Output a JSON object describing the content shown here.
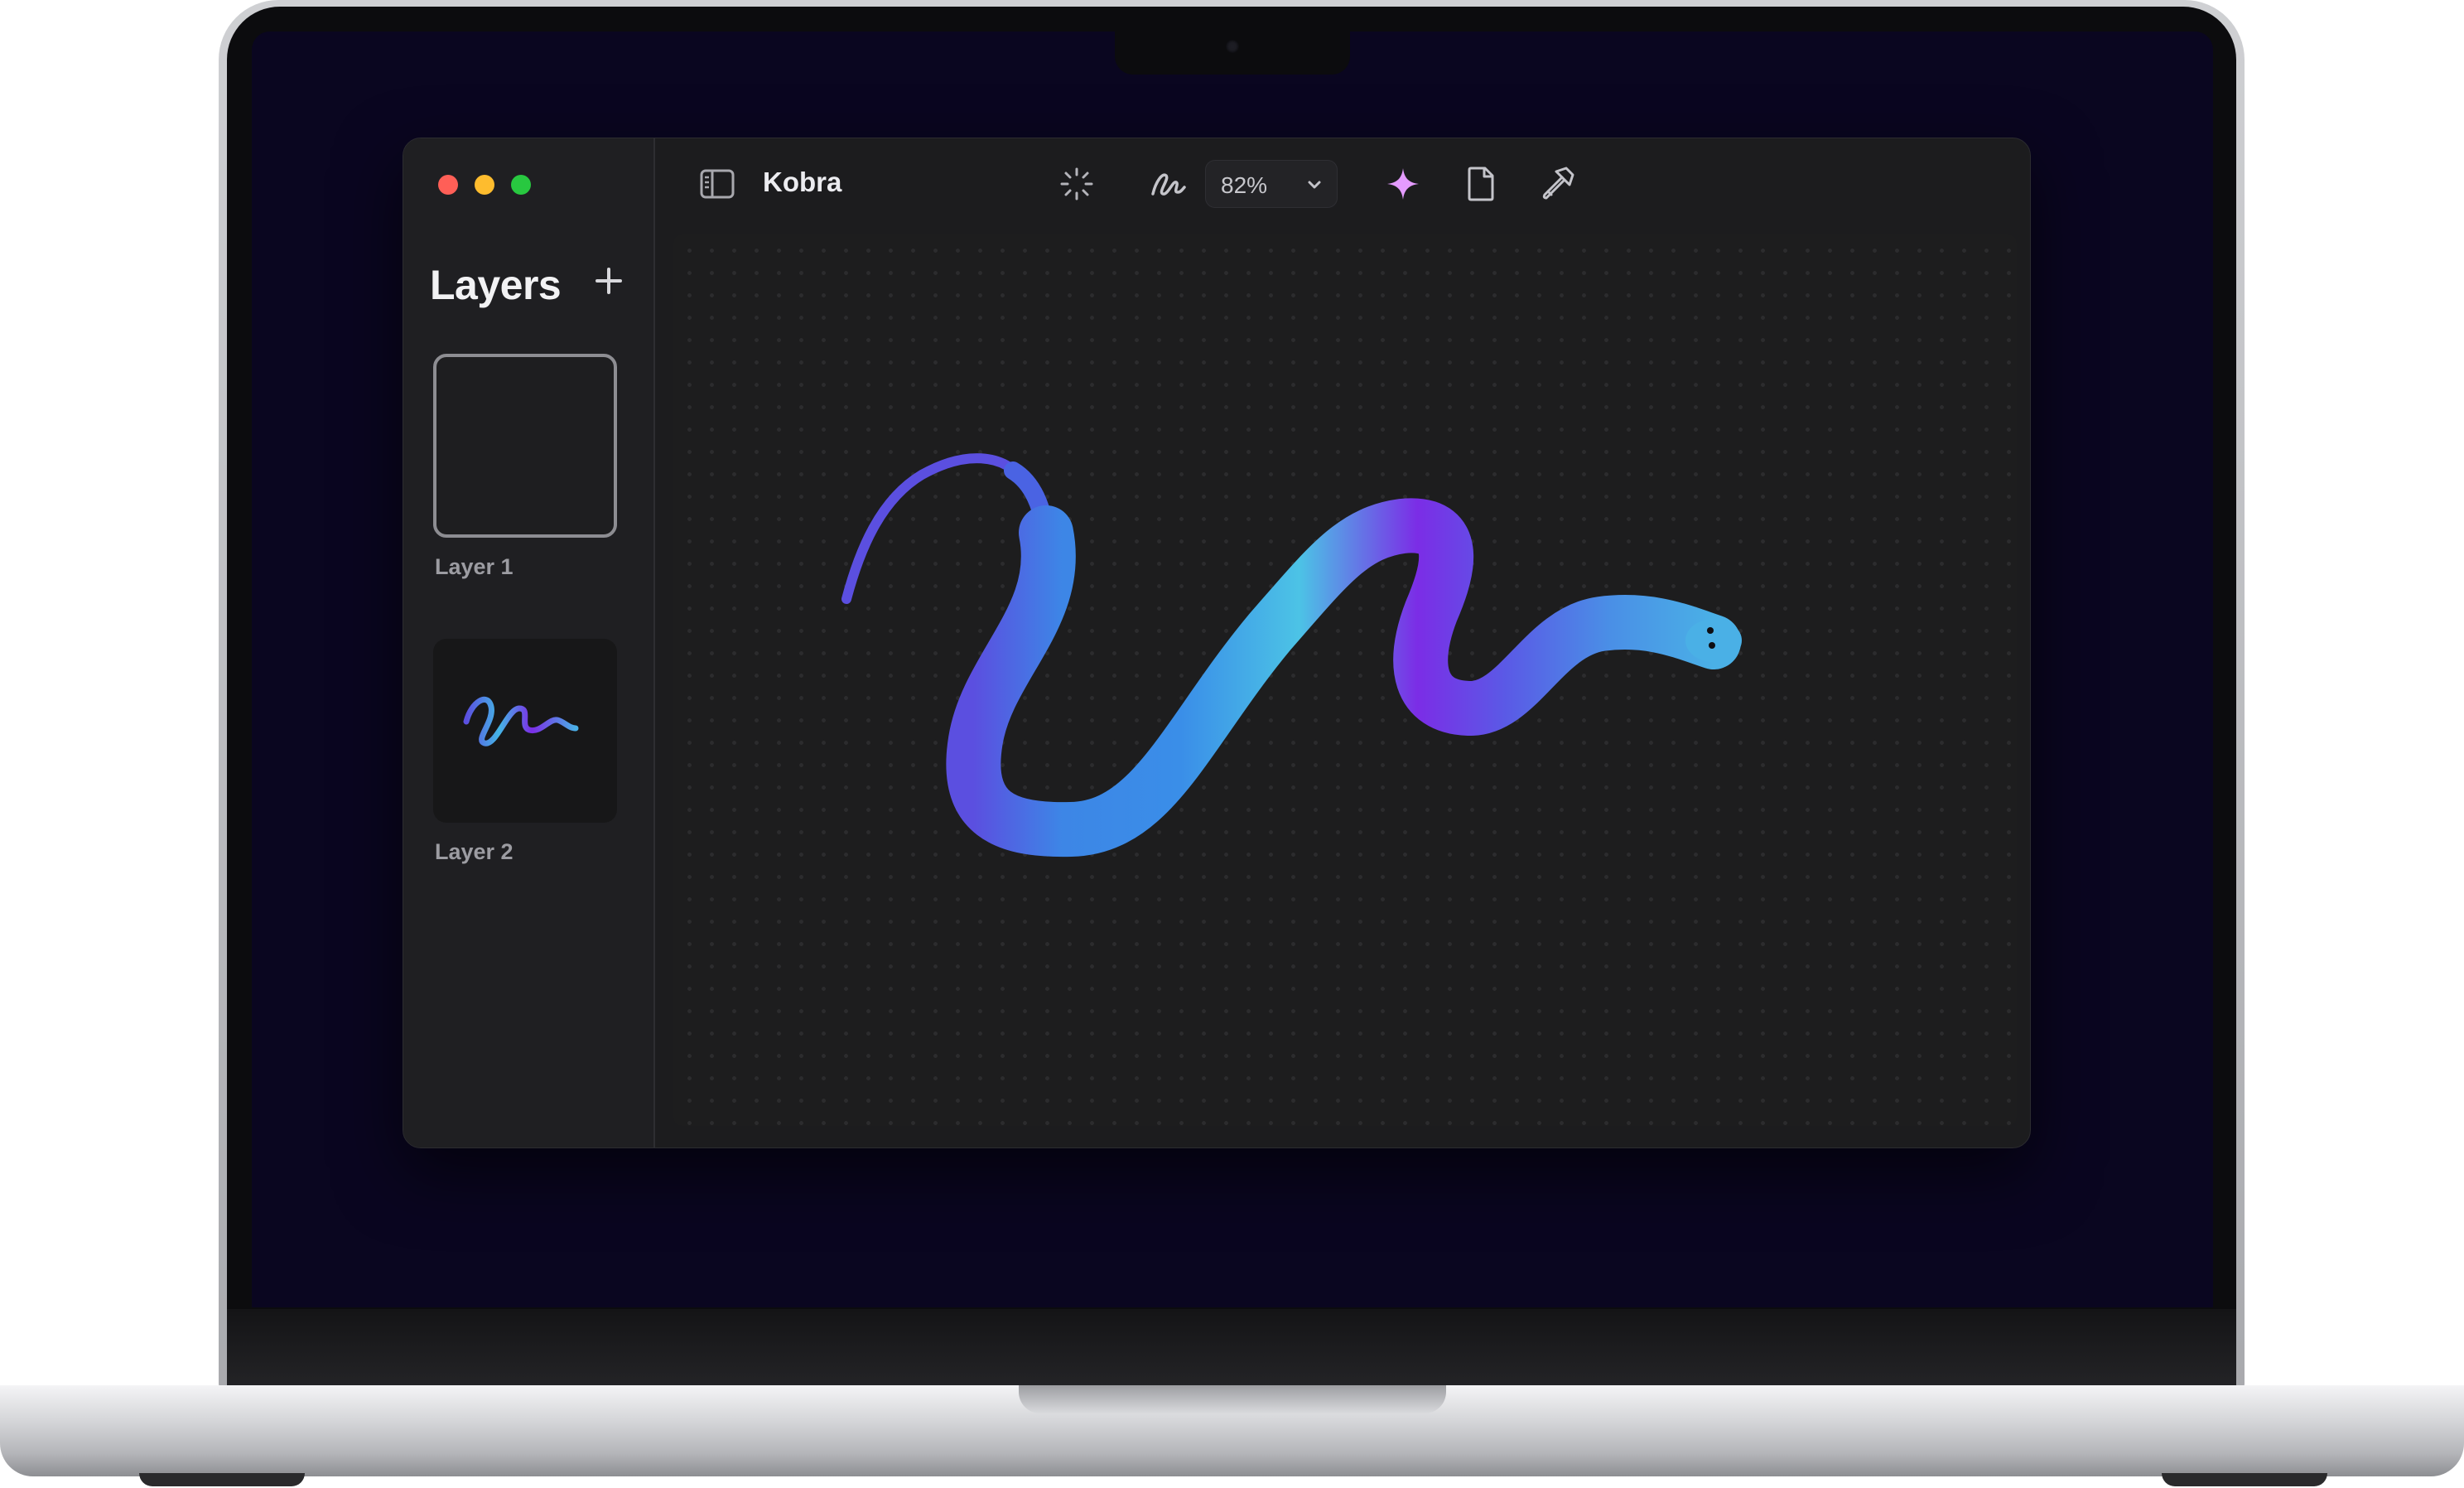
{
  "window": {
    "title": "Kobra",
    "traffic_lights": {
      "close_color": "#ff5f57",
      "minimize_color": "#febc2e",
      "zoom_color": "#28c840"
    }
  },
  "sidebar": {
    "title": "Layers",
    "add_icon": "plus-icon",
    "layers": [
      {
        "label": "Layer 1",
        "selected": true,
        "empty": true
      },
      {
        "label": "Layer 2",
        "selected": false,
        "empty": false
      }
    ]
  },
  "toolbar": {
    "sidebar_toggle_icon": "sidebar-icon",
    "tools": [
      "sparkle-loading-icon",
      "pen-scribble-icon",
      "target-icon",
      "pointer-icon"
    ],
    "zoom": {
      "value": "82%",
      "chevron_icon": "chevron-down-icon"
    },
    "actions": [
      "magic-sparkle-icon",
      "document-icon",
      "hammer-icon"
    ],
    "accent_color": "#e49bff"
  },
  "canvas": {
    "stroke_gradient": [
      "#5b4fe0",
      "#3d86e6",
      "#4cc3e6",
      "#7b2de6",
      "#4a8fe6",
      "#4ab0e6"
    ]
  }
}
